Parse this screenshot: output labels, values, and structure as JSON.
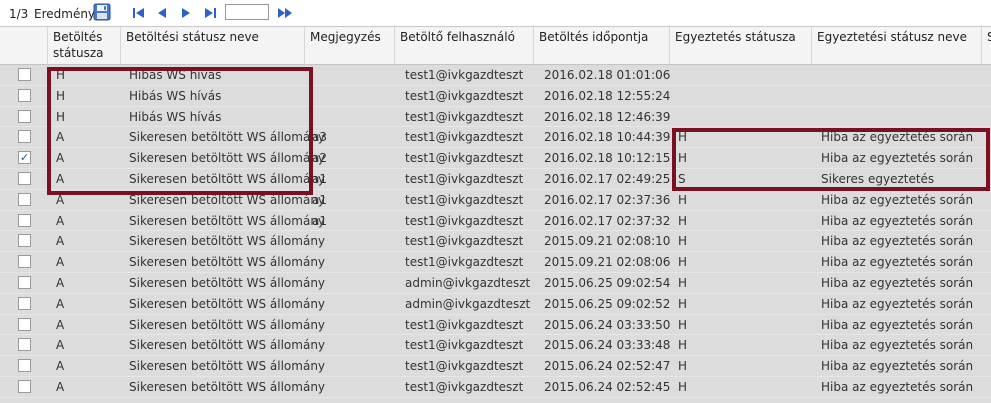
{
  "toolbar": {
    "page_indicator": "1/3",
    "result_label": "Eredmény",
    "page_input_value": ""
  },
  "columns": [
    "Betöltés státusza",
    "Betöltési státusz neve",
    "Megjegyzés",
    "Betöltő felhasználó",
    "Betöltés időpontja",
    "Egyeztetés státusza",
    "Egyeztetési státusz neve",
    "S"
  ],
  "rows": [
    {
      "checked": false,
      "status": "H",
      "status_name": "Hibás WS hívás",
      "note": "",
      "user": "test1@ivkgazdteszt",
      "time": "2016.02.18 01:01:06",
      "rec_status": "",
      "rec_status_name": ""
    },
    {
      "checked": false,
      "status": "H",
      "status_name": "Hibás WS hívás",
      "note": "",
      "user": "test1@ivkgazdteszt",
      "time": "2016.02.18 12:55:24",
      "rec_status": "",
      "rec_status_name": ""
    },
    {
      "checked": false,
      "status": "H",
      "status_name": "Hibás WS hívás",
      "note": "",
      "user": "test1@ivkgazdteszt",
      "time": "2016.02.18 12:46:39",
      "rec_status": "",
      "rec_status_name": ""
    },
    {
      "checked": false,
      "status": "A",
      "status_name": "Sikeresen betöltött WS állomány",
      "note": "a3",
      "user": "test1@ivkgazdteszt",
      "time": "2016.02.18 10:44:39",
      "rec_status": "H",
      "rec_status_name": "Hiba az egyeztetés során"
    },
    {
      "checked": true,
      "status": "A",
      "status_name": "Sikeresen betöltött WS állomány",
      "note": "a2",
      "user": "test1@ivkgazdteszt",
      "time": "2016.02.18 10:12:15",
      "rec_status": "H",
      "rec_status_name": "Hiba az egyeztetés során"
    },
    {
      "checked": false,
      "status": "A",
      "status_name": "Sikeresen betöltött WS állomány",
      "note": "a1",
      "user": "test1@ivkgazdteszt",
      "time": "2016.02.17 02:49:25",
      "rec_status": "S",
      "rec_status_name": "Sikeres egyeztetés"
    },
    {
      "checked": false,
      "status": "A",
      "status_name": "Sikeresen betöltött WS állomány",
      "note": "a1",
      "user": "test1@ivkgazdteszt",
      "time": "2016.02.17 02:37:36",
      "rec_status": "H",
      "rec_status_name": "Hiba az egyeztetés során"
    },
    {
      "checked": false,
      "status": "A",
      "status_name": "Sikeresen betöltött WS állomány",
      "note": "a1",
      "user": "test1@ivkgazdteszt",
      "time": "2016.02.17 02:37:32",
      "rec_status": "H",
      "rec_status_name": "Hiba az egyeztetés során"
    },
    {
      "checked": false,
      "status": "A",
      "status_name": "Sikeresen betöltött WS állomány",
      "note": "",
      "user": "test1@ivkgazdteszt",
      "time": "2015.09.21 02:08:10",
      "rec_status": "H",
      "rec_status_name": "Hiba az egyeztetés során"
    },
    {
      "checked": false,
      "status": "A",
      "status_name": "Sikeresen betöltött WS állomány",
      "note": "",
      "user": "test1@ivkgazdteszt",
      "time": "2015.09.21 02:08:06",
      "rec_status": "H",
      "rec_status_name": "Hiba az egyeztetés során"
    },
    {
      "checked": false,
      "status": "A",
      "status_name": "Sikeresen betöltött WS állomány",
      "note": "",
      "user": "admin@ivkgazdteszt",
      "time": "2015.06.25 09:02:54",
      "rec_status": "H",
      "rec_status_name": "Hiba az egyeztetés során"
    },
    {
      "checked": false,
      "status": "A",
      "status_name": "Sikeresen betöltött WS állomány",
      "note": "",
      "user": "admin@ivkgazdteszt",
      "time": "2015.06.25 09:02:52",
      "rec_status": "H",
      "rec_status_name": "Hiba az egyeztetés során"
    },
    {
      "checked": false,
      "status": "A",
      "status_name": "Sikeresen betöltött WS állomány",
      "note": "",
      "user": "test1@ivkgazdteszt",
      "time": "2015.06.24 03:33:50",
      "rec_status": "H",
      "rec_status_name": "Hiba az egyeztetés során"
    },
    {
      "checked": false,
      "status": "A",
      "status_name": "Sikeresen betöltött WS állomány",
      "note": "",
      "user": "test1@ivkgazdteszt",
      "time": "2015.06.24 03:33:48",
      "rec_status": "H",
      "rec_status_name": "Hiba az egyeztetés során"
    },
    {
      "checked": false,
      "status": "A",
      "status_name": "Sikeresen betöltött WS állomány",
      "note": "",
      "user": "test1@ivkgazdteszt",
      "time": "2015.06.24 02:52:47",
      "rec_status": "H",
      "rec_status_name": "Hiba az egyeztetés során"
    },
    {
      "checked": false,
      "status": "A",
      "status_name": "Sikeresen betöltött WS állomány",
      "note": "",
      "user": "test1@ivkgazdteszt",
      "time": "2015.06.24 02:52:45",
      "rec_status": "H",
      "rec_status_name": "Hiba az egyeztetés során"
    }
  ],
  "colors": {
    "highlight": "#7b1020",
    "nav_icon": "#2a63c8"
  },
  "icons": {
    "save": "save-icon",
    "first_page": "first-page-icon",
    "prev_page": "prev-page-icon",
    "next_page": "next-page-icon",
    "last_page": "last-page-icon",
    "go": "go-icon"
  }
}
